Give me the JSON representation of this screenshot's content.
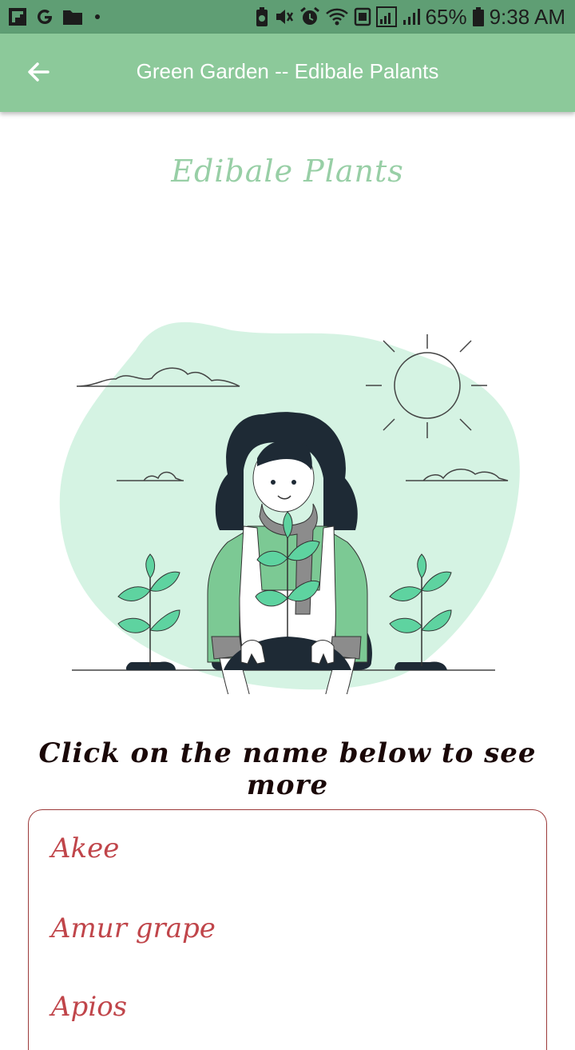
{
  "status_bar": {
    "battery_percent": "65%",
    "time": "9:38 AM",
    "icons": [
      "flipboard-icon",
      "google-icon",
      "folder-icon",
      "dot-icon",
      "battery-saver-icon",
      "mute-icon",
      "alarm-icon",
      "wifi-icon",
      "sim-icon",
      "signal-icon",
      "battery-icon"
    ]
  },
  "app_bar": {
    "title": "Green Garden -- Edibale Palants",
    "back_icon": "arrow-left-icon",
    "background": "#8cc99a"
  },
  "main": {
    "section_title": "Edibale Plants",
    "instruction": "Click on the name below to see more",
    "plants": [
      {
        "label": "Akee"
      },
      {
        "label": "Amur grape"
      },
      {
        "label": "Apios"
      }
    ]
  },
  "colors": {
    "accent": "#8cc99a",
    "plant_name": "#c0454a",
    "list_border": "#9c3b3b",
    "blob": "#d5f3e3"
  }
}
